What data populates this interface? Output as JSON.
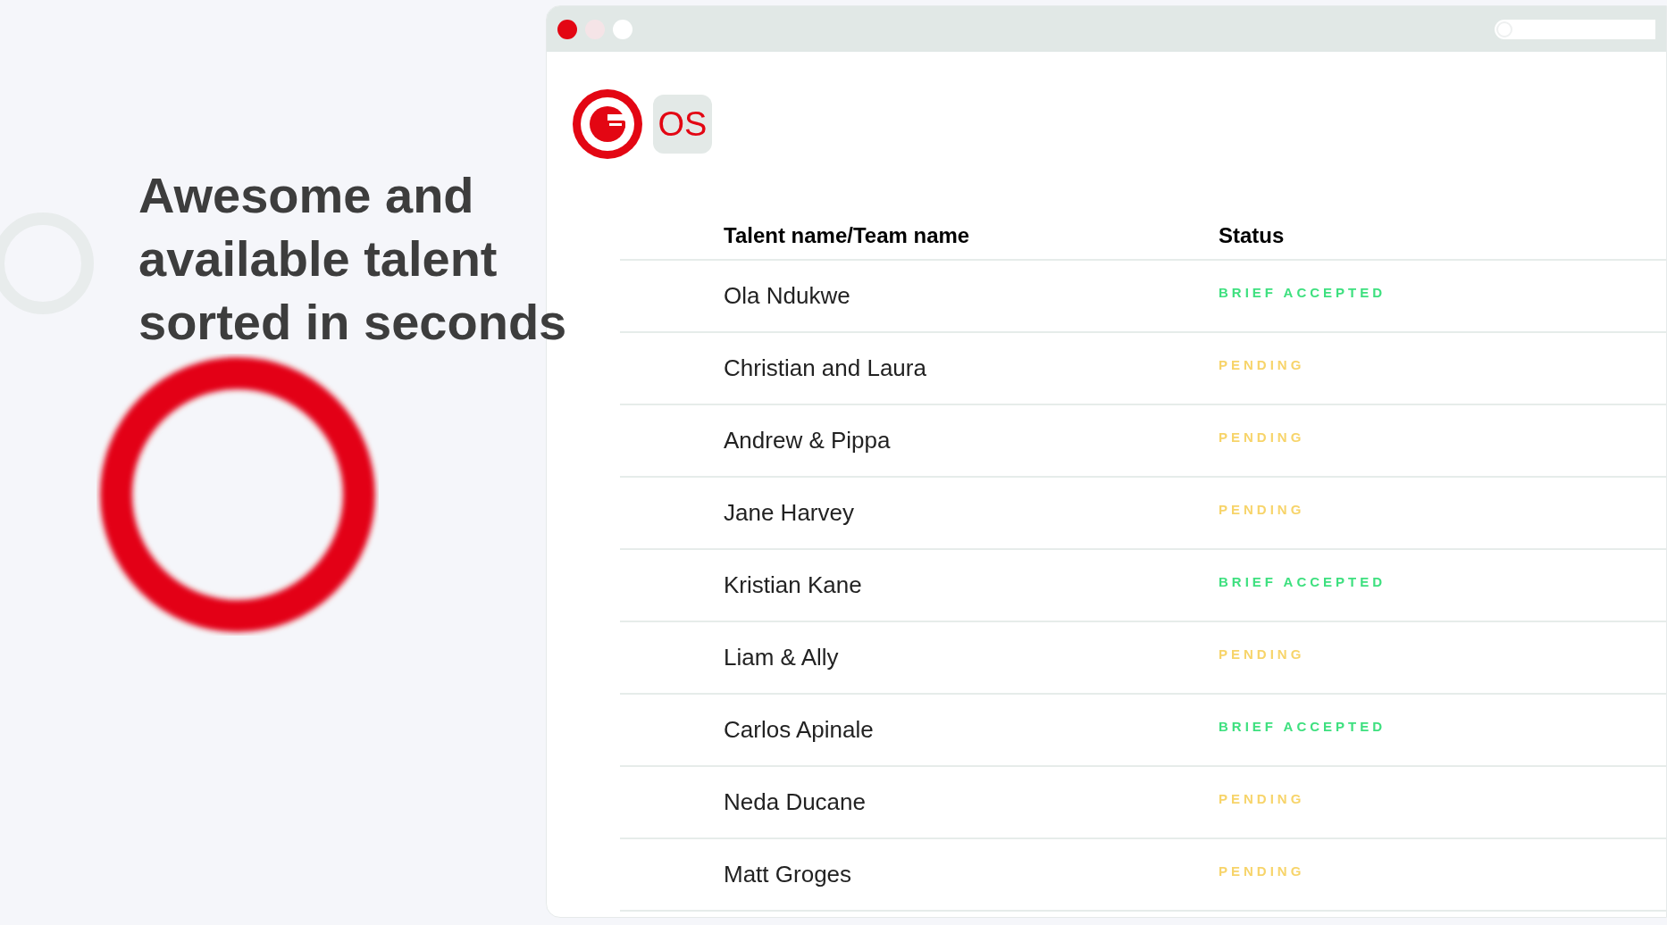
{
  "headline": "Awesome and available talent sorted in seconds",
  "logo": {
    "badge": "OS"
  },
  "table": {
    "columns": [
      "Talent name/Team name",
      "Status"
    ],
    "rows": [
      {
        "name": "Ola Ndukwe",
        "status": "BRIEF ACCEPTED",
        "color": "#3ee07f"
      },
      {
        "name": "Christian and Laura",
        "status": "PENDING",
        "color": "#f7d46a"
      },
      {
        "name": "Andrew & Pippa",
        "status": "PENDING",
        "color": "#f7d46a"
      },
      {
        "name": "Jane Harvey",
        "status": "PENDING",
        "color": "#f7d46a"
      },
      {
        "name": "Kristian Kane",
        "status": "BRIEF ACCEPTED",
        "color": "#3ee07f"
      },
      {
        "name": "Liam & Ally",
        "status": "PENDING",
        "color": "#f7d46a"
      },
      {
        "name": "Carlos Apinale",
        "status": "BRIEF ACCEPTED",
        "color": "#3ee07f"
      },
      {
        "name": "Neda Ducane",
        "status": "PENDING",
        "color": "#f7d46a"
      },
      {
        "name": "Matt Groges",
        "status": "PENDING",
        "color": "#f7d46a"
      }
    ]
  }
}
